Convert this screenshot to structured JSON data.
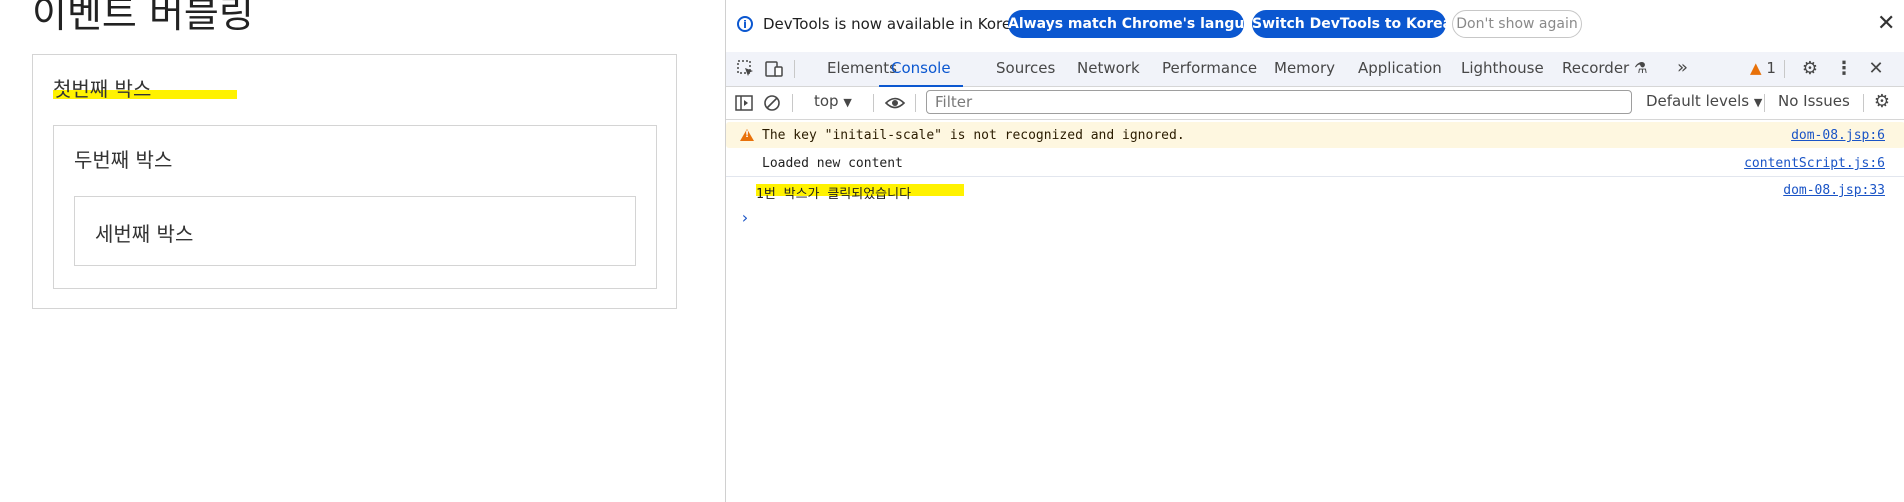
{
  "page": {
    "title": "이벤트 버블링",
    "box1_label": "첫번째 박스",
    "box2_label": "두번째 박스",
    "box3_label": "세번째 박스"
  },
  "devtools": {
    "infobar": {
      "text": "DevTools is now available in Korean!",
      "btn_match": "Always match Chrome's language",
      "btn_switch": "Switch DevTools to Korean",
      "btn_dismiss": "Don't show again"
    },
    "tabs": [
      "Elements",
      "Console",
      "Sources",
      "Network",
      "Performance",
      "Memory",
      "Application",
      "Lighthouse",
      "Recorder"
    ],
    "active_tab": "Console",
    "issues_badge": "1",
    "toolbar": {
      "context": "top",
      "filter_placeholder": "Filter",
      "levels": "Default levels",
      "issues": "No Issues"
    },
    "messages": [
      {
        "type": "warning",
        "text": "The key \"initail-scale\" is not recognized and ignored.",
        "source": "dom-08.jsp:6"
      },
      {
        "type": "log",
        "text": "Loaded new content",
        "source": "contentScript.js:6"
      },
      {
        "type": "log",
        "text": "1번 박스가 클릭되었습니다",
        "source": "dom-08.jsp:33"
      }
    ],
    "prompt": "›"
  },
  "colors": {
    "accent": "#0b57d0",
    "highlight": "#fff200",
    "warning_bg": "#fef7e0",
    "warning_icon": "#e8710a"
  }
}
